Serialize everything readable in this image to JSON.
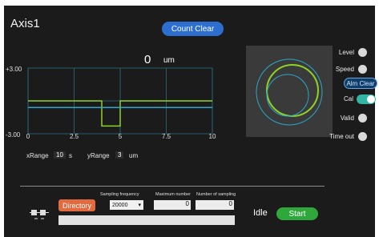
{
  "window": {
    "title": "Axis1"
  },
  "toolbar": {
    "count_clear_label": "Count Clear"
  },
  "readout": {
    "value": "0",
    "unit": "um"
  },
  "chart_data": {
    "type": "line",
    "title": "",
    "xlabel": "",
    "ylabel": "",
    "x_ticks": [
      "0",
      "2.5",
      "5",
      "7.5",
      "10"
    ],
    "y_ticks": [
      "+3.00",
      "-3.00"
    ],
    "xlim": [
      0,
      10
    ],
    "ylim": [
      -3,
      3
    ],
    "grid": true,
    "series": [
      {
        "color": "#8fd12a",
        "x": [
          0,
          4,
          4,
          5,
          5,
          10
        ],
        "y": [
          0,
          0,
          -2.3,
          -2.3,
          0,
          0
        ]
      },
      {
        "color": "#2aa7c9",
        "x": [
          0,
          10
        ],
        "y": [
          -0.6,
          -0.6
        ]
      }
    ]
  },
  "ranges": {
    "x_label": "xRange",
    "x_value": "10",
    "x_unit": "s",
    "y_label": "yRange",
    "y_value": "3",
    "y_unit": "um"
  },
  "status_panel": {
    "level_label": "Level",
    "speed_label": "Speed",
    "alm_clear_label": "Alm Clear",
    "cal_label": "Cal",
    "cal_on": true,
    "valid_label": "Valid",
    "timeout_label": "Time out"
  },
  "sampling": {
    "directory_label": "Directory",
    "frequency_label": "Sampling frequency",
    "frequency_value": "20000",
    "max_number_label": "Maximum number",
    "max_number_value": "0",
    "num_sampling_label": "Number of sampling",
    "num_sampling_value": "0",
    "progress": 0
  },
  "run": {
    "status": "Idle",
    "start_label": "Start"
  },
  "colors": {
    "background": "#1b1b1b",
    "accent_blue": "#2d6fd1",
    "green": "#2ea83a",
    "orange": "#e26a3e",
    "teal": "#33b5a3"
  }
}
